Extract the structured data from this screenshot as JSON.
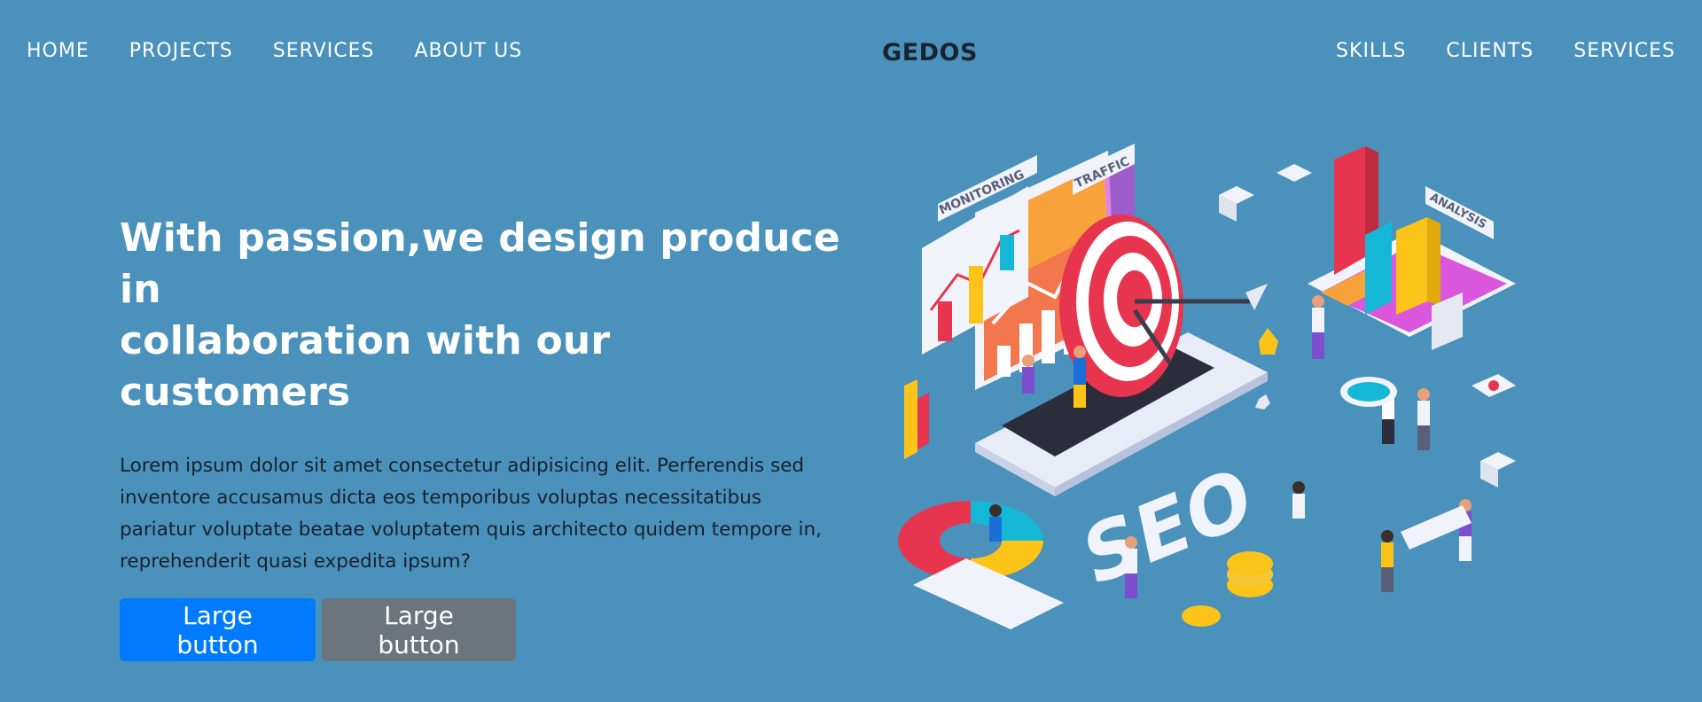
{
  "nav": {
    "left": [
      "HOME",
      "PROJECTS",
      "SERVICES",
      "ABOUT US"
    ],
    "brand": "GEDOS",
    "right": [
      "SKILLS",
      "CLIENTS",
      "SERVICES"
    ]
  },
  "hero": {
    "title_line1": "With passion,we design produce in",
    "title_line2": "collaboration with our customers",
    "body": "Lorem ipsum dolor sit amet consectetur adipisicing elit. Perferendis sed inventore accusamus dicta eos temporibus voluptas necessitatibus pariatur voluptate beatae voluptatem quis architecto quidem tempore in, reprehenderit quasi expedita ipsum?",
    "btn_primary": "Large button",
    "btn_secondary": "Large button"
  },
  "illustration": {
    "label_monitoring": "MONITORING",
    "label_traffic": "TRAFFIC",
    "label_analysis": "ANALYSIS",
    "label_seo": "SEO"
  },
  "colors": {
    "background": "#4a91bb",
    "primary": "#007bff",
    "secondary": "#6c757d",
    "brand": "#1a2330"
  }
}
